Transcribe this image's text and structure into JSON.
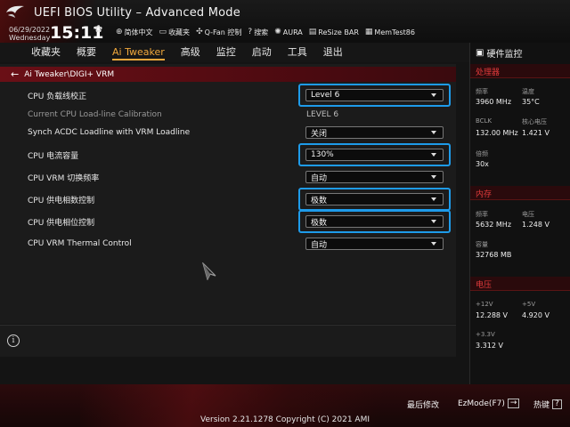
{
  "header": {
    "title": "UEFI BIOS Utility – Advanced Mode",
    "date": "06/29/2022",
    "weekday": "Wednesday",
    "time": "15:11",
    "tools": [
      {
        "icon": "globe-icon",
        "glyph": "⊕",
        "label": "简体中文"
      },
      {
        "icon": "bookmark-icon",
        "glyph": "▭",
        "label": "收藏夹"
      },
      {
        "icon": "fan-icon",
        "glyph": "✣",
        "label": "Q-Fan 控制"
      },
      {
        "icon": "help-icon",
        "glyph": "?",
        "label": "搜索"
      },
      {
        "icon": "aura-icon",
        "glyph": "✺",
        "label": "AURA"
      },
      {
        "icon": "resize-bar-icon",
        "glyph": "▤",
        "label": "ReSize BAR"
      },
      {
        "icon": "memtest-icon",
        "glyph": "▦",
        "label": "MemTest86"
      }
    ]
  },
  "menu": {
    "tabs": [
      "收藏夹",
      "概要",
      "Ai Tweaker",
      "高级",
      "监控",
      "启动",
      "工具",
      "退出"
    ],
    "active": "Ai Tweaker"
  },
  "main": {
    "breadcrumb": "Ai Tweaker\\DIGI+ VRM",
    "rows": [
      {
        "label": "CPU 负载线校正",
        "value": "Level 6",
        "type": "dropdown",
        "highlight": true
      },
      {
        "label": "Current CPU Load-line Calibration",
        "value": "LEVEL 6",
        "type": "text",
        "dim": true
      },
      {
        "label": "Synch ACDC Loadline with VRM Loadline",
        "value": "关闭",
        "type": "dropdown",
        "highlight": false
      },
      {
        "label": "CPU 电流容量",
        "value": "130%",
        "type": "dropdown",
        "highlight": true
      },
      {
        "label": "CPU VRM 切换频率",
        "value": "自动",
        "type": "dropdown",
        "highlight": false
      },
      {
        "label": "CPU 供电相数控制",
        "value": "极数",
        "type": "dropdown",
        "highlight": true
      },
      {
        "label": "CPU 供电相位控制",
        "value": "极数",
        "type": "dropdown",
        "highlight": true
      },
      {
        "label": "CPU VRM Thermal Control",
        "value": "自动",
        "type": "dropdown",
        "highlight": false
      }
    ]
  },
  "monitor": {
    "title": "硬件监控",
    "cpu": {
      "section": "处理器",
      "freq_label": "频率",
      "freq": "3960 MHz",
      "temp_label": "温度",
      "temp": "35°C",
      "bclk_label": "BCLK",
      "bclk": "132.00 MHz",
      "vcore_label": "核心电压",
      "vcore": "1.421 V",
      "ratio_label": "倍频",
      "ratio": "30x"
    },
    "memory": {
      "section": "内存",
      "freq_label": "频率",
      "freq": "5632 MHz",
      "volt_label": "电压",
      "volt": "1.248 V",
      "cap_label": "容量",
      "cap": "32768 MB"
    },
    "voltage": {
      "section": "电压",
      "v12_label": "+12V",
      "v12": "12.288 V",
      "v5_label": "+5V",
      "v5": "4.920 V",
      "v33_label": "+3.3V",
      "v33": "3.312 V"
    }
  },
  "footer": {
    "last_modified": "最后修改",
    "ezmode": "EzMode(F7)",
    "hotkeys": "热键",
    "version": "Version 2.21.1278 Copyright (C) 2021 AMI"
  },
  "colors": {
    "accent": "#f0a83c",
    "highlight": "#1e9bea",
    "section_red": "#e23b3b"
  }
}
